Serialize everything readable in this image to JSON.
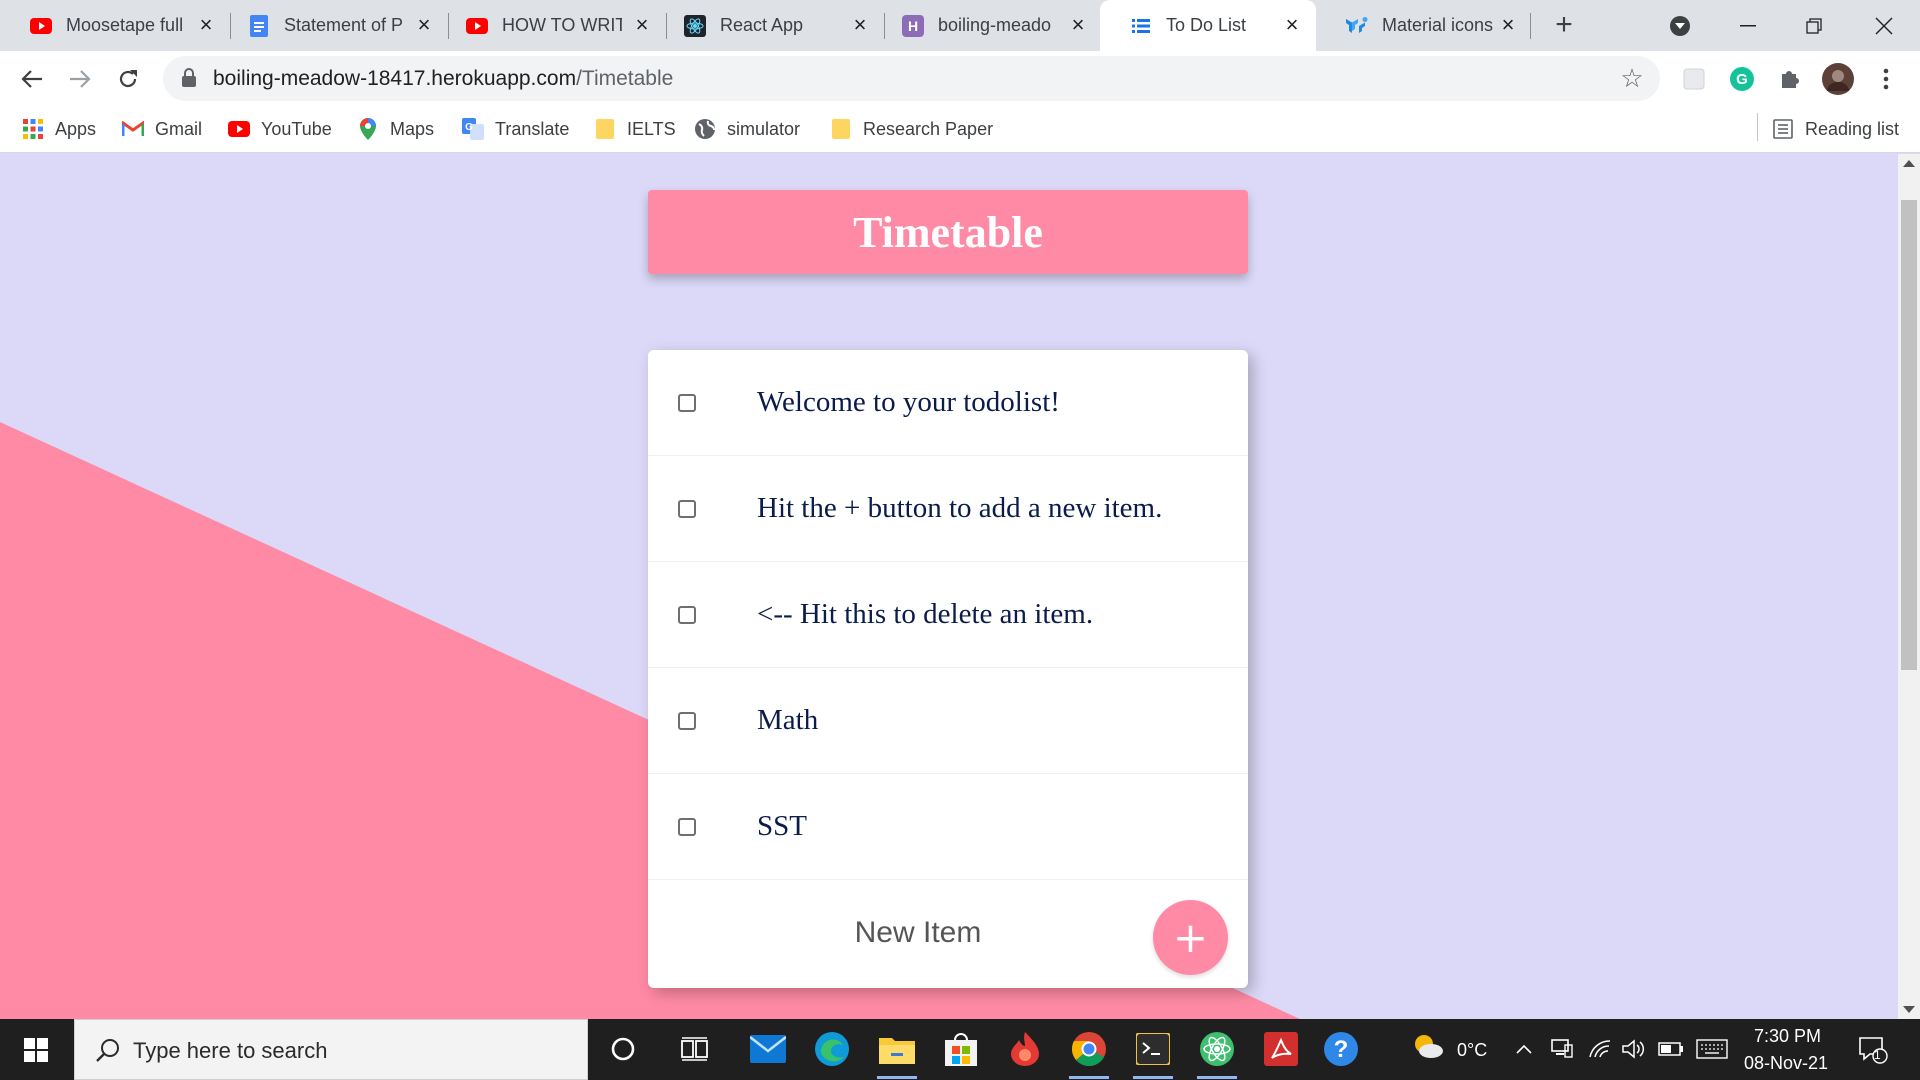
{
  "browser": {
    "tabs": [
      {
        "title": "Moosetape full",
        "icon": "youtube-icon",
        "active": false
      },
      {
        "title": "Statement of P",
        "icon": "google-docs-icon",
        "active": false
      },
      {
        "title": "HOW TO WRITE",
        "icon": "youtube-icon",
        "active": false
      },
      {
        "title": "React App",
        "icon": "react-icon",
        "active": false
      },
      {
        "title": "boiling-meado",
        "icon": "heroku-icon",
        "active": false
      },
      {
        "title": "To Do List",
        "icon": "list-icon",
        "active": true
      },
      {
        "title": "Material icons",
        "icon": "material-ui-icon",
        "active": false
      }
    ],
    "url_host": "boiling-meadow-18417.herokuapp.com",
    "url_path": "/Timetable",
    "bookmarks": [
      {
        "label": "Apps",
        "icon": "apps-grid-icon"
      },
      {
        "label": "Gmail",
        "icon": "gmail-icon"
      },
      {
        "label": "YouTube",
        "icon": "youtube-icon"
      },
      {
        "label": "Maps",
        "icon": "maps-icon"
      },
      {
        "label": "Translate",
        "icon": "translate-icon"
      },
      {
        "label": "IELTS",
        "icon": "folder-icon"
      },
      {
        "label": "simulator",
        "icon": "globe-icon"
      },
      {
        "label": "Research Paper",
        "icon": "folder-icon"
      }
    ],
    "reading_list": "Reading list"
  },
  "page": {
    "heading": "Timetable",
    "items": [
      {
        "text": "Welcome to your todolist!",
        "checked": false
      },
      {
        "text": "Hit the + button to add a new item.",
        "checked": false
      },
      {
        "text": "<-- Hit this to delete an item.",
        "checked": false
      },
      {
        "text": "Math",
        "checked": false
      },
      {
        "text": "SST",
        "checked": false
      }
    ],
    "new_item_placeholder": "New Item",
    "add_button_label": "+",
    "colors": {
      "accent": "#ff8aa5",
      "background": "#dcd9f8",
      "item_text": "#0c1c4a"
    }
  },
  "taskbar": {
    "search_placeholder": "Type here to search",
    "temperature": "0°C",
    "time": "7:30 PM",
    "date": "08-Nov-21",
    "notification_count": "1"
  }
}
